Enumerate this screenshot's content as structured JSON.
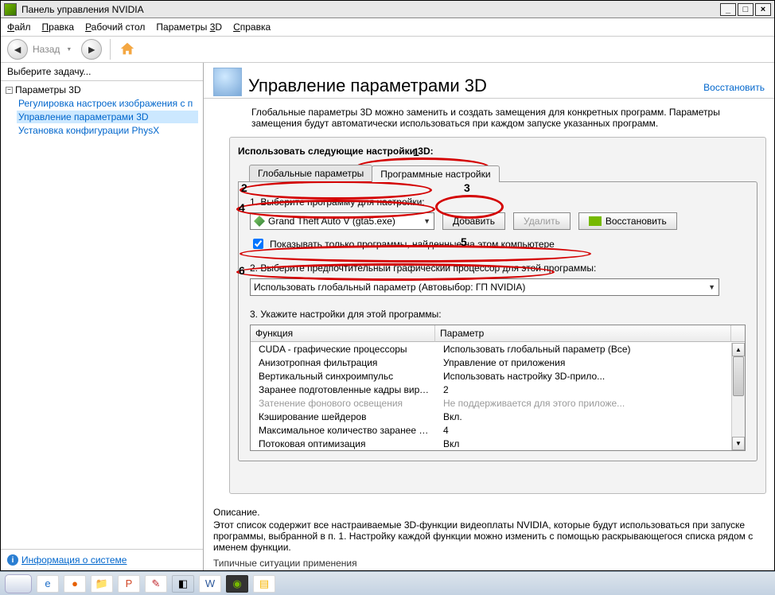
{
  "window": {
    "title": "Панель управления NVIDIA"
  },
  "menu": {
    "file": "Файл",
    "edit": "Правка",
    "desk": "Рабочий стол",
    "params": "Параметры 3D",
    "help": "Справка"
  },
  "toolbar": {
    "back": "Назад"
  },
  "sidebar": {
    "task": "Выберите задачу...",
    "root": "Параметры 3D",
    "items": [
      "Регулировка настроек изображения с п",
      "Управление параметрами 3D",
      "Установка конфигурации PhysX"
    ],
    "sysinfo": "Информация о системе"
  },
  "header": {
    "title": "Управление параметрами 3D",
    "restore": "Восстановить"
  },
  "intro": "Глобальные параметры 3D можно заменить и создать замещения для конкретных программ. Параметры замещения будут автоматически использоваться при каждом запуске указанных программ.",
  "panel": {
    "title": "Использовать следующие настройки 3D:",
    "tab_global": "Глобальные параметры",
    "tab_program": "Программные настройки",
    "step1_label": "1. Выберите программу для настройки:",
    "program": "Grand Theft Auto V (gta5.exe)",
    "add": "Добавить",
    "remove": "Удалить",
    "restore": "Восстановить",
    "show_only": "Показывать только программы, найденные на этом компьютере",
    "step2_label": "2. Выберите предпочтительный графический процессор для этой программы:",
    "gpu": "Использовать глобальный параметр (Автовыбор: ГП NVIDIA)",
    "step3_label": "3. Укажите настройки для этой программы:",
    "th_func": "Функция",
    "th_param": "Параметр",
    "rows": [
      {
        "f": "CUDA - графические процессоры",
        "p": "Использовать глобальный параметр (Все)"
      },
      {
        "f": "Анизотропная фильтрация",
        "p": "Управление от приложения"
      },
      {
        "f": "Вертикальный синхроимпульс",
        "p": "Использовать настройку 3D-прило..."
      },
      {
        "f": "Заранее подготовленные кадры вирту...",
        "p": "2"
      },
      {
        "f": "Затенение фонового освещения",
        "p": "Не поддерживается для этого приложе...",
        "dim": true
      },
      {
        "f": "Кэширование шейдеров",
        "p": "Вкл."
      },
      {
        "f": "Максимальное количество заранее под...",
        "p": "4"
      },
      {
        "f": "Потоковая оптимизация",
        "p": "Вкл"
      }
    ]
  },
  "footer": {
    "hdr": "Описание.",
    "text": "Этот список содержит все настраиваемые 3D-функции видеоплаты NVIDIA, которые будут использоваться при запуске программы, выбранной в п. 1. Настройку каждой функции можно изменить с помощью раскрывающегося списка рядом с именем функции.",
    "typ": "Типичные ситуации применения"
  }
}
